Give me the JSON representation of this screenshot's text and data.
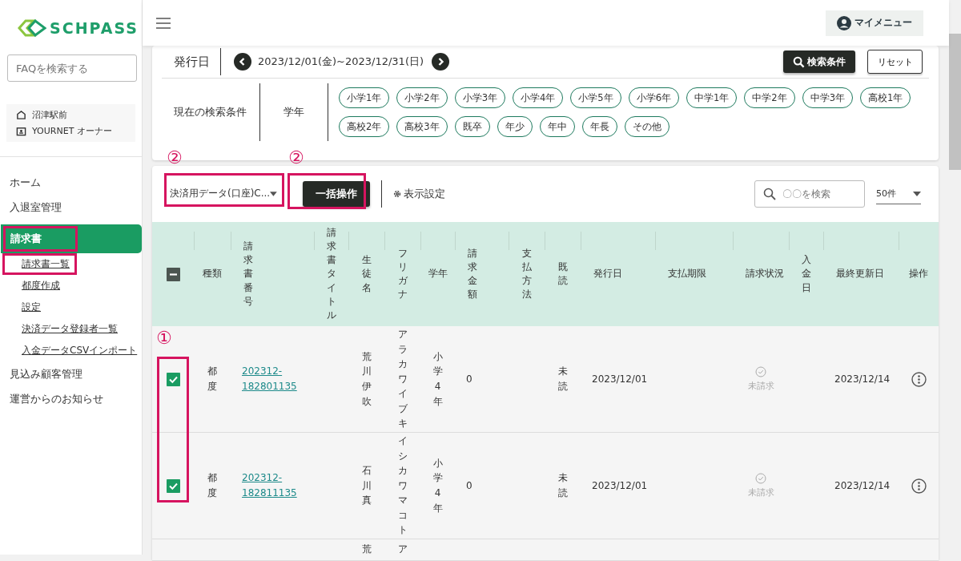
{
  "sidebar": {
    "logo": "SCHPASS",
    "faq_search": {
      "placeholder": "FAQを検索する"
    },
    "school": "沼津駅前",
    "role": "YOURNET オーナー",
    "nav": [
      {
        "label": "ホーム",
        "selected": false,
        "highlighted": false
      },
      {
        "label": "入退室管理",
        "selected": false,
        "highlighted": false
      },
      {
        "label": "請求書",
        "selected": true,
        "highlighted": true,
        "children": [
          {
            "label": "請求書一覧",
            "highlighted": true
          },
          {
            "label": "都度作成",
            "highlighted": false
          },
          {
            "label": "設定",
            "highlighted": false
          },
          {
            "label": "決済データ登録者一覧",
            "highlighted": false
          },
          {
            "label": "入金データCSVインポート",
            "highlighted": false
          }
        ]
      },
      {
        "label": "見込み顧客管理",
        "selected": false,
        "highlighted": false
      },
      {
        "label": "運営からのお知らせ",
        "selected": false,
        "highlighted": false
      }
    ]
  },
  "header": {
    "my_menu": "マイメニュー"
  },
  "filters": {
    "date_label": "発行日",
    "date_range": "2023/12/01(金)~2023/12/31(日)",
    "search_button": "検索条件",
    "reset_button": "リセット",
    "conditions_label": "現在の検索条件",
    "grade_label": "学年",
    "grade_chips": [
      "小学1年",
      "小学2年",
      "小学3年",
      "小学4年",
      "小学5年",
      "小学6年",
      "中学1年",
      "中学2年",
      "中学3年",
      "高校1年",
      "高校2年",
      "高校3年",
      "既卒",
      "年少",
      "年中",
      "年長",
      "その他"
    ]
  },
  "toolbar": {
    "export_select": {
      "value": "決済用データ(口座)C...",
      "annotation": "②"
    },
    "bulk_button": {
      "label": "一括操作",
      "annotation": "②"
    },
    "display_settings": "表示設定",
    "search": {
      "placeholder": "〇〇を検索"
    },
    "page_size": "50件"
  },
  "table": {
    "select_all_indeterminate": true,
    "checkbox_annotation": "①",
    "columns": [
      "種類",
      "請求書番号",
      "請求書タイトル",
      "生徒名",
      "フリガナ",
      "学年",
      "請求金額",
      "支払方法",
      "既読",
      "発行日",
      "支払期限",
      "請求状況",
      "入金日",
      "最終更新日",
      "操作"
    ],
    "rows": [
      {
        "checked": true,
        "type": "都度",
        "number": "202312-182801135",
        "student": "荒川伊吹",
        "furigana": "アラカワイブキ",
        "grade": "小学4年",
        "amount": "0",
        "read": "未読",
        "issued": "2023/12/01",
        "status": "未請求",
        "last_updated": "2023/12/14"
      },
      {
        "checked": true,
        "type": "都度",
        "number": "202312-182811135",
        "student": "石川真",
        "furigana": "イシカワマコト",
        "grade": "小学4年",
        "amount": "0",
        "read": "未読",
        "issued": "2023/12/01",
        "status": "未請求",
        "last_updated": "2023/12/14"
      },
      {
        "student": "荒",
        "furigana": "ア"
      }
    ]
  }
}
